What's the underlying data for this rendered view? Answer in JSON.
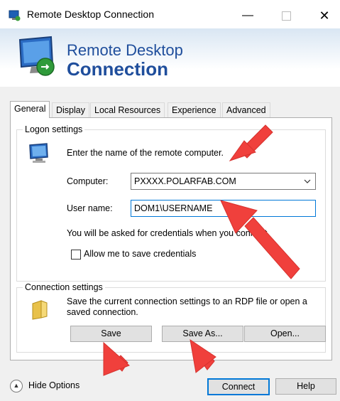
{
  "window": {
    "title": "Remote Desktop Connection",
    "min_glyph": "—",
    "close_glyph": "✕"
  },
  "banner": {
    "line1": "Remote Desktop",
    "line2": "Connection"
  },
  "tabs": [
    {
      "label": "General",
      "active": true
    },
    {
      "label": "Display",
      "active": false
    },
    {
      "label": "Local Resources",
      "active": false
    },
    {
      "label": "Experience",
      "active": false
    },
    {
      "label": "Advanced",
      "active": false
    }
  ],
  "logon": {
    "group_label": "Logon settings",
    "instruction": "Enter the name of the remote computer.",
    "computer_label": "Computer:",
    "computer_value": "PXXXX.POLARFAB.COM",
    "username_label": "User name:",
    "username_value": "DOM1\\USERNAME",
    "credentials_note": "You will be asked for credentials when you connect.",
    "save_credentials_label": "Allow me to save credentials",
    "save_credentials_checked": false
  },
  "connection": {
    "group_label": "Connection settings",
    "description": "Save the current connection settings to an RDP file or open a saved connection.",
    "save_label": "Save",
    "save_as_label": "Save As...",
    "open_label": "Open..."
  },
  "footer": {
    "hide_options_label": "Hide Options",
    "connect_label": "Connect",
    "help_label": "Help"
  },
  "colors": {
    "accent": "#0078d7",
    "banner_text": "#1f4e9c",
    "annotation_arrow": "#f0403c"
  }
}
